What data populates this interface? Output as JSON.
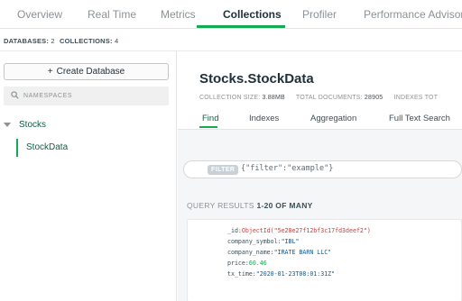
{
  "nav": {
    "tabs": [
      {
        "label": "Overview"
      },
      {
        "label": "Real Time"
      },
      {
        "label": "Metrics"
      },
      {
        "label": "Collections",
        "active": true
      },
      {
        "label": "Profiler"
      },
      {
        "label": "Performance Advisor"
      }
    ]
  },
  "status": {
    "databases_label": "DATABASES:",
    "databases_count": "2",
    "collections_label": "COLLECTIONS:",
    "collections_count": "4"
  },
  "sidebar": {
    "create_database_label": "Create Database",
    "namespace_placeholder": "NAMESPACES",
    "database": "Stocks",
    "collection": "StockData"
  },
  "main": {
    "title": "Stocks.StockData",
    "collection_size_label": "COLLECTION SIZE:",
    "collection_size": "3.88MB",
    "total_documents_label": "TOTAL DOCUMENTS:",
    "total_documents": "28905",
    "indexes_total_label": "INDEXES TOT",
    "subtabs": [
      {
        "label": "Find",
        "active": true
      },
      {
        "label": "Indexes"
      },
      {
        "label": "Aggregation"
      },
      {
        "label": "Full Text Search"
      }
    ],
    "filter_badge": "FILTER",
    "filter_value": "{\"filter\":\"example\"}",
    "results_label": "QUERY RESULTS",
    "results_range": "1-20 OF MANY",
    "document": [
      {
        "key": "_id",
        "value": "ObjectId(\"5e28e27f12bf3c17fd3deef2\")",
        "type": "oid"
      },
      {
        "key": "company_symbol",
        "value": "\"IBL\"",
        "type": "str"
      },
      {
        "key": "company_name",
        "value": "\"IRATE BARN LLC\"",
        "type": "str"
      },
      {
        "key": "price",
        "value": "60.46",
        "type": "num"
      },
      {
        "key": "tx_time",
        "value": "\"2020-01-23T08:01:31Z\"",
        "type": "str"
      }
    ]
  },
  "colors": {
    "accent_green": "#13aa52",
    "text_dark_green": "#116149",
    "oid_red": "#c43e3e",
    "string_blue": "#145a8c"
  }
}
